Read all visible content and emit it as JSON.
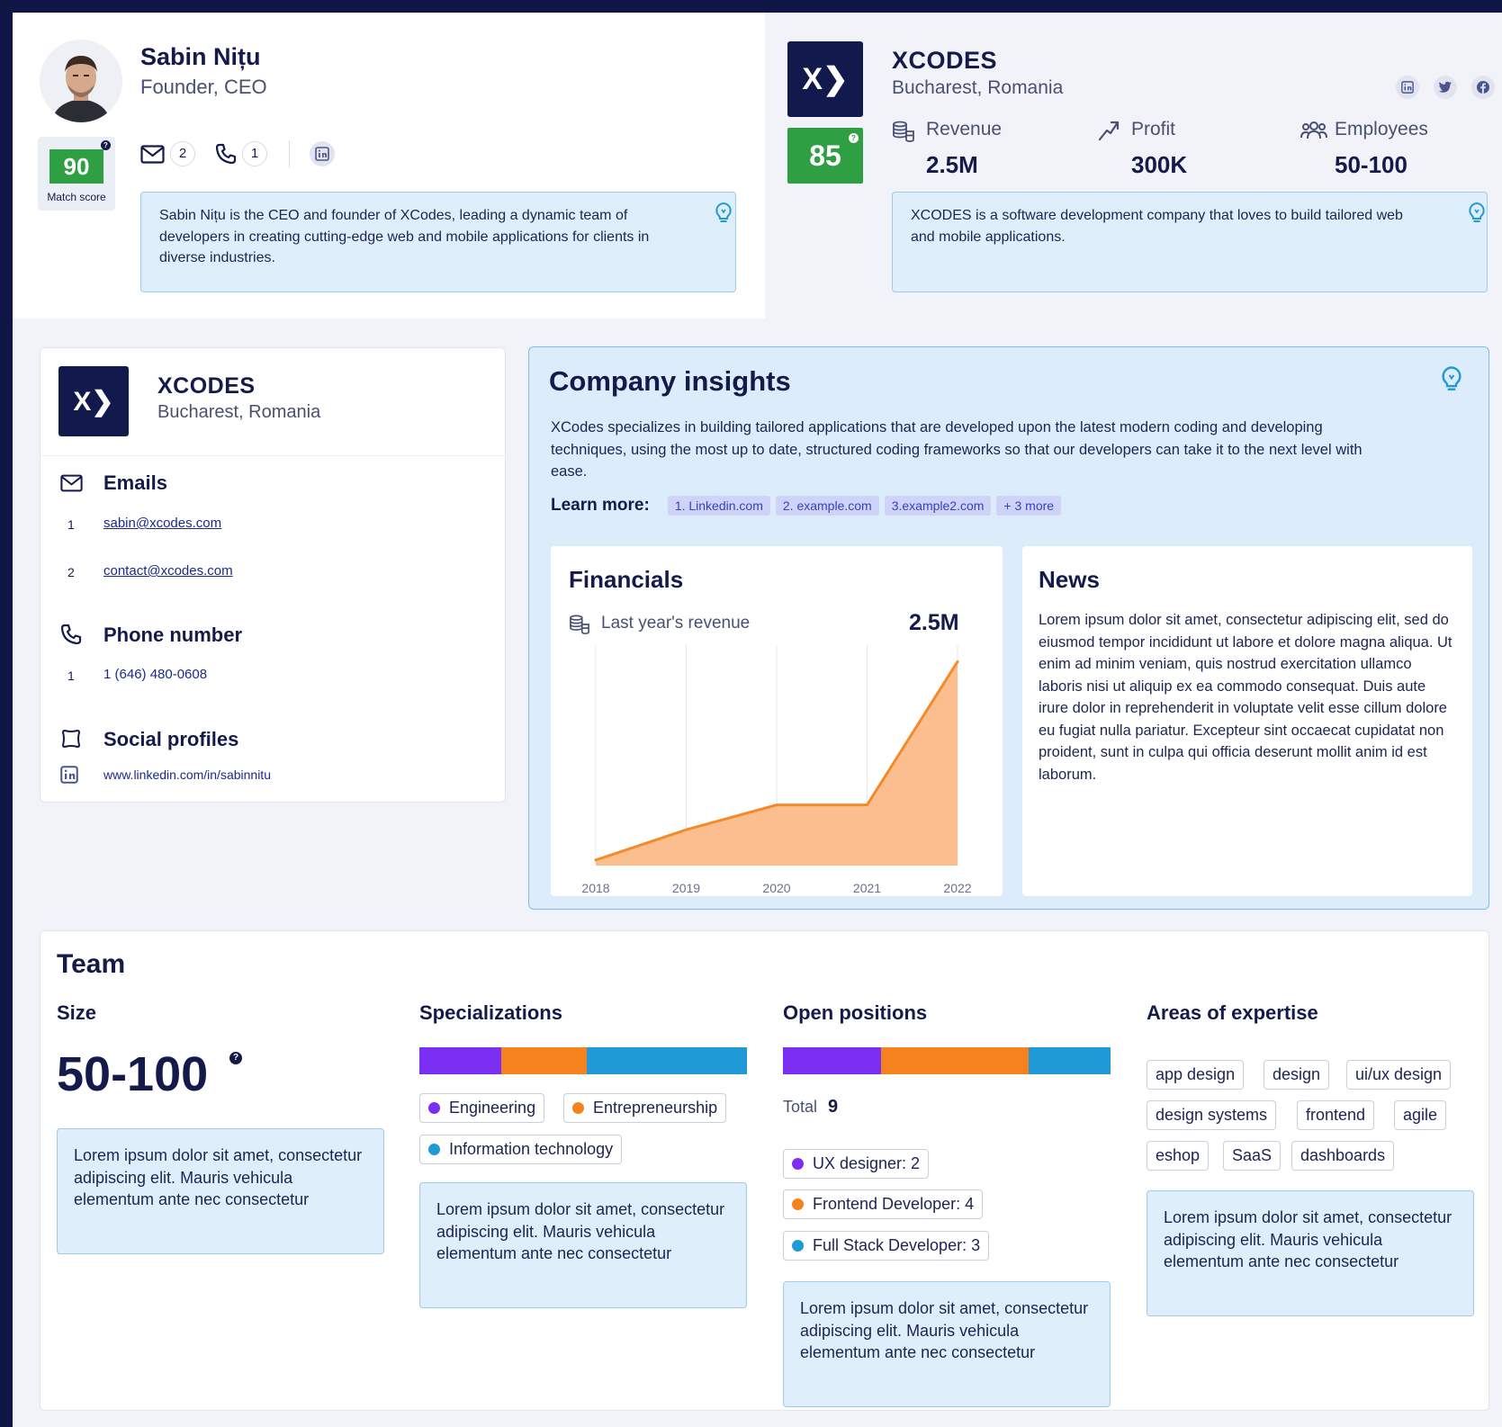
{
  "person": {
    "name": "Sabin Nițu",
    "role": "Founder, CEO",
    "match_score": "90",
    "match_score_label": "Match score",
    "email_count": "2",
    "phone_count": "1",
    "bio": "Sabin Nițu is the CEO and founder of XCodes, leading a dynamic team of developers in creating cutting-edge web and mobile applications for clients in diverse industries."
  },
  "company": {
    "logo_text": "X❯",
    "name": "XCODES",
    "location": "Bucharest, Romania",
    "score": "85",
    "stats": [
      {
        "label": "Revenue",
        "value": "2.5M",
        "icon": "coins-icon"
      },
      {
        "label": "Profit",
        "value": "300K",
        "icon": "trend-up-icon"
      },
      {
        "label": "Employees",
        "value": "50-100",
        "icon": "people-icon"
      }
    ],
    "description": "XCODES is a software development company that loves to build tailored web and mobile applications."
  },
  "contact_card": {
    "company_name": "XCODES",
    "company_location": "Bucharest, Romania",
    "emails_title": "Emails",
    "emails": [
      {
        "index": "1",
        "address": "sabin@xcodes.com"
      },
      {
        "index": "2",
        "address": "contact@xcodes.com"
      }
    ],
    "phone_title": "Phone number",
    "phones": [
      {
        "index": "1",
        "number": "1 (646) 480-0608"
      }
    ],
    "social_title": "Social profiles",
    "social_link": "www.linkedin.com/in/sabinnitu"
  },
  "insights": {
    "title": "Company insights",
    "text": "XCodes specializes in building tailored applications that are developed upon the latest modern coding and developing techniques, using the most up to date, structured coding frameworks so that our developers can take it to the next level with ease.",
    "learn_more_label": "Learn more:",
    "links": [
      "1. Linkedin.com",
      "2. example.com",
      "3.example2.com",
      "+ 3 more"
    ],
    "financials_title": "Financials",
    "revenue_label": "Last year's revenue",
    "revenue_value": "2.5M",
    "news_title": "News",
    "news_text": "Lorem ipsum dolor sit amet, consectetur adipiscing elit, sed do eiusmod tempor incididunt ut labore et dolore magna aliqua. Ut enim ad minim veniam, quis nostrud exercitation ullamco laboris nisi ut aliquip ex ea commodo consequat. Duis aute irure dolor in reprehenderit in voluptate velit esse cillum dolore eu fugiat nulla pariatur. Excepteur sint occaecat cupidatat non proident, sunt in culpa qui officia deserunt mollit anim id est laborum."
  },
  "chart_data": {
    "type": "area",
    "x": [
      "2018",
      "2019",
      "2020",
      "2021",
      "2022"
    ],
    "values": [
      0.1,
      0.65,
      1.1,
      1.1,
      3.7
    ],
    "ylim": [
      0,
      4
    ],
    "color": "#f58a2a",
    "fill": "#fbbe8f",
    "grid": "vertical"
  },
  "team": {
    "title": "Team",
    "size_title": "Size",
    "size_value": "50-100",
    "size_text": "Lorem ipsum dolor sit amet, consectetur adipiscing elit. Mauris vehicula elementum ante nec consectetur",
    "spec_title": "Specializations",
    "spec_bar": [
      {
        "share": 0.25,
        "color": "#7b2ff2"
      },
      {
        "share": 0.26,
        "color": "#f5821f"
      },
      {
        "share": 0.49,
        "color": "#1f9ad6"
      }
    ],
    "specializations": [
      {
        "label": "Engineering",
        "color": "#7b2ff2"
      },
      {
        "label": "Entrepreneurship",
        "color": "#f5821f"
      },
      {
        "label": "Information technology",
        "color": "#1f9ad6"
      }
    ],
    "spec_text": "Lorem ipsum dolor sit amet, consectetur adipiscing elit. Mauris vehicula elementum ante nec consectetur",
    "open_title": "Open positions",
    "open_bar": [
      {
        "share": 0.3,
        "color": "#7b2ff2"
      },
      {
        "share": 0.45,
        "color": "#f5821f"
      },
      {
        "share": 0.25,
        "color": "#1f9ad6"
      }
    ],
    "total_label": "Total",
    "total_value": "9",
    "positions": [
      {
        "label": "UX designer: 2",
        "color": "#7b2ff2"
      },
      {
        "label": "Frontend Developer: 4",
        "color": "#f5821f"
      },
      {
        "label": "Full Stack Developer: 3",
        "color": "#1f9ad6"
      }
    ],
    "open_text": "Lorem ipsum dolor sit amet, consectetur adipiscing elit. Mauris vehicula elementum ante nec consectetur",
    "areas_title": "Areas of expertise",
    "areas": [
      "app design",
      "design",
      "ui/ux design",
      "design systems",
      "frontend",
      "agile",
      "eshop",
      "SaaS",
      "dashboards"
    ],
    "areas_text": "Lorem ipsum dolor sit amet, consectetur adipiscing elit. Mauris vehicula elementum ante nec consectetur"
  }
}
